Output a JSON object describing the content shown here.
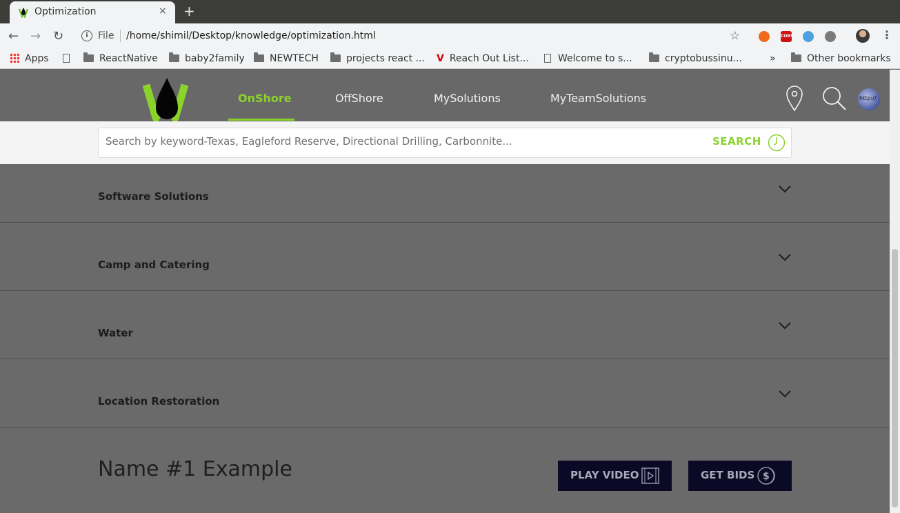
{
  "browser": {
    "tab": {
      "title": "Optimization",
      "close": "×"
    },
    "new_tab": "+",
    "nav": {
      "back": "←",
      "forward": "→",
      "reload": "↻"
    },
    "omnibox": {
      "info": "i",
      "scheme": "File",
      "url": "/home/shimil/Desktop/knowledge/optimization.html"
    },
    "star": "☆",
    "menu": "⋮",
    "extensions": [
      {
        "name": "extension-1",
        "color": "#f06a1e"
      },
      {
        "name": "extension-cors",
        "color": "#cc1111"
      },
      {
        "name": "extension-3",
        "color": "#4aa3e0"
      },
      {
        "name": "extension-abp",
        "color": "#7a7a7a"
      }
    ],
    "bookmarks": {
      "apps": "Apps",
      "items": [
        "ReactNative",
        "baby2family",
        "NEWTECH",
        "projects react ...",
        "Reach Out List...",
        "Welcome to s...",
        "cryptobussinu..."
      ],
      "overflow": "»",
      "other": "Other bookmarks"
    }
  },
  "site": {
    "nav": {
      "links": [
        "OnShore",
        "OffShore",
        "MySolutions",
        "MyTeamSolutions"
      ],
      "active": "OnShore"
    },
    "search": {
      "placeholder": "Search by keyword-Texas, Eagleford Reserve, Directional Drilling, Carbonnite...",
      "button": "SEARCH"
    },
    "accordion": [
      "Software Solutions",
      "Camp and Catering",
      "Water",
      "Location Restoration"
    ],
    "detail": {
      "name": "Name #1 Example",
      "play_video": "PLAY VIDEO",
      "get_bids": "GET BIDS"
    },
    "colors": {
      "accent": "#8bd22b",
      "nav_bg": "#686868",
      "button_bg": "#0b0a26"
    }
  }
}
